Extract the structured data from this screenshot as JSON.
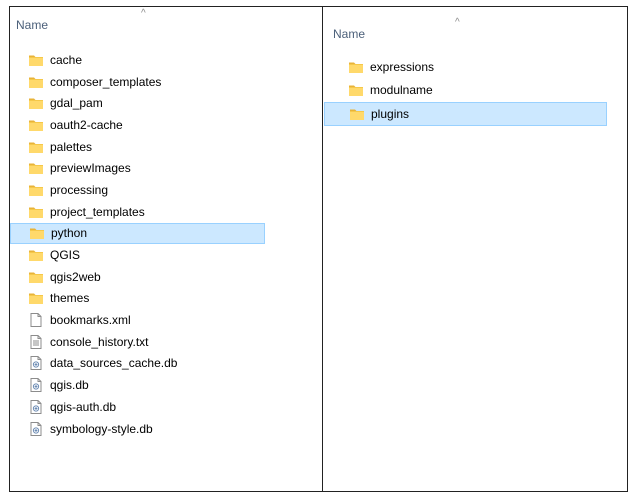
{
  "left_pane": {
    "column_header": "Name",
    "items": [
      {
        "name": "cache",
        "type": "folder",
        "icon": "folder-icon",
        "selected": false
      },
      {
        "name": "composer_templates",
        "type": "folder",
        "icon": "folder-icon",
        "selected": false
      },
      {
        "name": "gdal_pam",
        "type": "folder",
        "icon": "folder-icon",
        "selected": false
      },
      {
        "name": "oauth2-cache",
        "type": "folder",
        "icon": "folder-icon",
        "selected": false
      },
      {
        "name": "palettes",
        "type": "folder",
        "icon": "folder-icon",
        "selected": false
      },
      {
        "name": "previewImages",
        "type": "folder",
        "icon": "folder-icon",
        "selected": false
      },
      {
        "name": "processing",
        "type": "folder",
        "icon": "folder-icon",
        "selected": false
      },
      {
        "name": "project_templates",
        "type": "folder",
        "icon": "folder-icon",
        "selected": false
      },
      {
        "name": "python",
        "type": "folder",
        "icon": "folder-icon",
        "selected": true
      },
      {
        "name": "QGIS",
        "type": "folder",
        "icon": "folder-icon",
        "selected": false
      },
      {
        "name": "qgis2web",
        "type": "folder",
        "icon": "folder-icon",
        "selected": false
      },
      {
        "name": "themes",
        "type": "folder",
        "icon": "folder-icon",
        "selected": false
      },
      {
        "name": "bookmarks.xml",
        "type": "file",
        "icon": "blank-file-icon",
        "selected": false
      },
      {
        "name": "console_history.txt",
        "type": "text",
        "icon": "text-file-icon",
        "selected": false
      },
      {
        "name": "data_sources_cache.db",
        "type": "db",
        "icon": "db-file-icon",
        "selected": false
      },
      {
        "name": "qgis.db",
        "type": "db",
        "icon": "db-file-icon",
        "selected": false
      },
      {
        "name": "qgis-auth.db",
        "type": "db",
        "icon": "db-file-icon",
        "selected": false
      },
      {
        "name": "symbology-style.db",
        "type": "db",
        "icon": "db-file-icon",
        "selected": false
      }
    ]
  },
  "right_pane": {
    "column_header": "Name",
    "items": [
      {
        "name": "expressions",
        "type": "folder",
        "icon": "folder-icon",
        "selected": false
      },
      {
        "name": "modulname",
        "type": "folder",
        "icon": "folder-icon",
        "selected": false
      },
      {
        "name": "plugins",
        "type": "folder",
        "icon": "folder-icon",
        "selected": true
      }
    ]
  },
  "colors": {
    "selection_fill": "#cce8ff",
    "selection_border": "#99d1ff",
    "header_text": "#4c607a",
    "folder": "#ffd96b"
  }
}
